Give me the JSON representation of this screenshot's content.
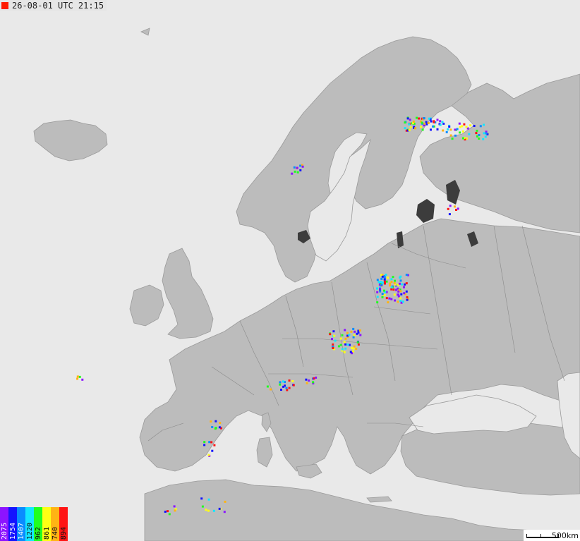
{
  "map": {
    "timestamp": "26-08-01 UTC 21:15",
    "status_color": "#ff1a00",
    "scale_label": "500km",
    "legend": [
      {
        "label": "2075",
        "color": "#8c14ff",
        "dark": true
      },
      {
        "label": "1754",
        "color": "#1414ff",
        "dark": true
      },
      {
        "label": "1407",
        "color": "#0a8cff",
        "dark": true
      },
      {
        "label": "1220",
        "color": "#14e6ff",
        "dark": false
      },
      {
        "label": "962",
        "color": "#20ff20",
        "dark": false
      },
      {
        "label": "861",
        "color": "#ffff14",
        "dark": false
      },
      {
        "label": "740",
        "color": "#ffb414",
        "dark": false
      },
      {
        "label": "894",
        "color": "#ff1414",
        "dark": false
      }
    ],
    "colors": {
      "sea": "#e9e9e9",
      "land": "#bcbcbc",
      "lake": "#3c3c3c",
      "border": "#8a8a8a"
    }
  }
}
